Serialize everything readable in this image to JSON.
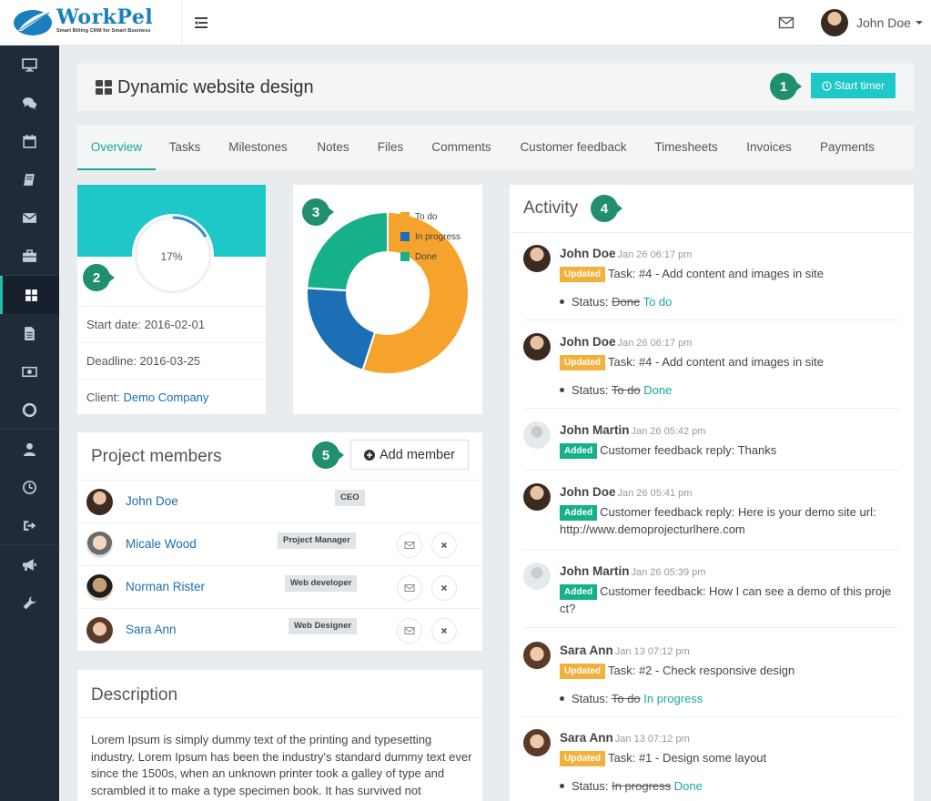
{
  "app": {
    "logo_text": "WorkPel",
    "logo_tagline": "Smart Billing CRM for Smart Business",
    "user_name": "John Doe"
  },
  "sidebar": {
    "items": [
      "monitor-icon",
      "comments-icon",
      "calendar-icon",
      "book-icon",
      "envelope-icon",
      "briefcase-icon",
      "grid-icon",
      "file-icon",
      "money-icon",
      "lifebuoy-icon",
      "user-icon",
      "clock-icon",
      "sign-out-icon",
      "bullhorn-icon",
      "wrench-icon"
    ],
    "active": "grid-icon"
  },
  "header": {
    "title": "Dynamic website design",
    "start_timer": "Start timer"
  },
  "tabs": [
    "Overview",
    "Tasks",
    "Milestones",
    "Notes",
    "Files",
    "Comments",
    "Customer feedback",
    "Timesheets",
    "Invoices",
    "Payments"
  ],
  "active_tab": "Overview",
  "progress": {
    "percent_label": "17%",
    "value": 0.17,
    "start_date": "Start date: 2016-02-01",
    "deadline": "Deadline: 2016-03-25",
    "client_label": "Client:",
    "client_name": "Demo Company"
  },
  "chart_data": {
    "type": "pie",
    "categories": [
      "To do",
      "In progress",
      "Done"
    ],
    "values": [
      55,
      21,
      24
    ],
    "colors": [
      "#f5a32d",
      "#1c6eb5",
      "#16b08a"
    ],
    "legend_position": "top-right"
  },
  "members": {
    "title": "Project members",
    "add_label": "Add member",
    "rows": [
      {
        "name": "John Doe",
        "role": "CEO",
        "actions": false
      },
      {
        "name": "Micale Wood",
        "role": "Project Manager",
        "actions": true
      },
      {
        "name": "Norman Rister",
        "role": "Web developer",
        "actions": true
      },
      {
        "name": "Sara Ann",
        "role": "Web Designer",
        "actions": true
      }
    ]
  },
  "description": {
    "title": "Description",
    "body": "Lorem Ipsum is simply dummy text of the printing and typesetting industry. Lorem Ipsum has been the industry's standard dummy text ever since the 1500s, when an unknown printer took a galley of type and scrambled it to make a type specimen book. It has survived not"
  },
  "activity": {
    "title": "Activity",
    "items": [
      {
        "user": "John Doe",
        "time": "Jan 26 06:17 pm",
        "badge": "Updated",
        "text": "Task: #4 - Add content and images in site",
        "status_label": "Status:",
        "old": "Done",
        "new": "To do"
      },
      {
        "user": "John Doe",
        "time": "Jan 26 06:17 pm",
        "badge": "Updated",
        "text": "Task: #4 - Add content and images in site",
        "status_label": "Status:",
        "old": "To do",
        "new": "Done"
      },
      {
        "user": "John Martin",
        "time": "Jan 26 05:42 pm",
        "badge": "Added",
        "text": "Customer feedback reply: Thanks"
      },
      {
        "user": "John Doe",
        "time": "Jan 26 05:41 pm",
        "badge": "Added",
        "text": "Customer feedback reply: Here is your demo site url: http://www.demoprojecturlhere.com"
      },
      {
        "user": "John Martin",
        "time": "Jan 26 05:39 pm",
        "badge": "Added",
        "text": "Customer feedback: How I can see a demo of this proje ct?"
      },
      {
        "user": "Sara Ann",
        "time": "Jan 13 07:12 pm",
        "badge": "Updated",
        "text": "Task: #2 - Check responsive design",
        "status_label": "Status:",
        "old": "To do",
        "new": "In progress"
      },
      {
        "user": "Sara Ann",
        "time": "Jan 13 07:12 pm",
        "badge": "Updated",
        "text": "Task: #1 - Design some layout",
        "status_label": "Status:",
        "old": "In progress",
        "new": "Done"
      }
    ]
  },
  "callouts": [
    "1",
    "2",
    "3",
    "4",
    "5"
  ]
}
